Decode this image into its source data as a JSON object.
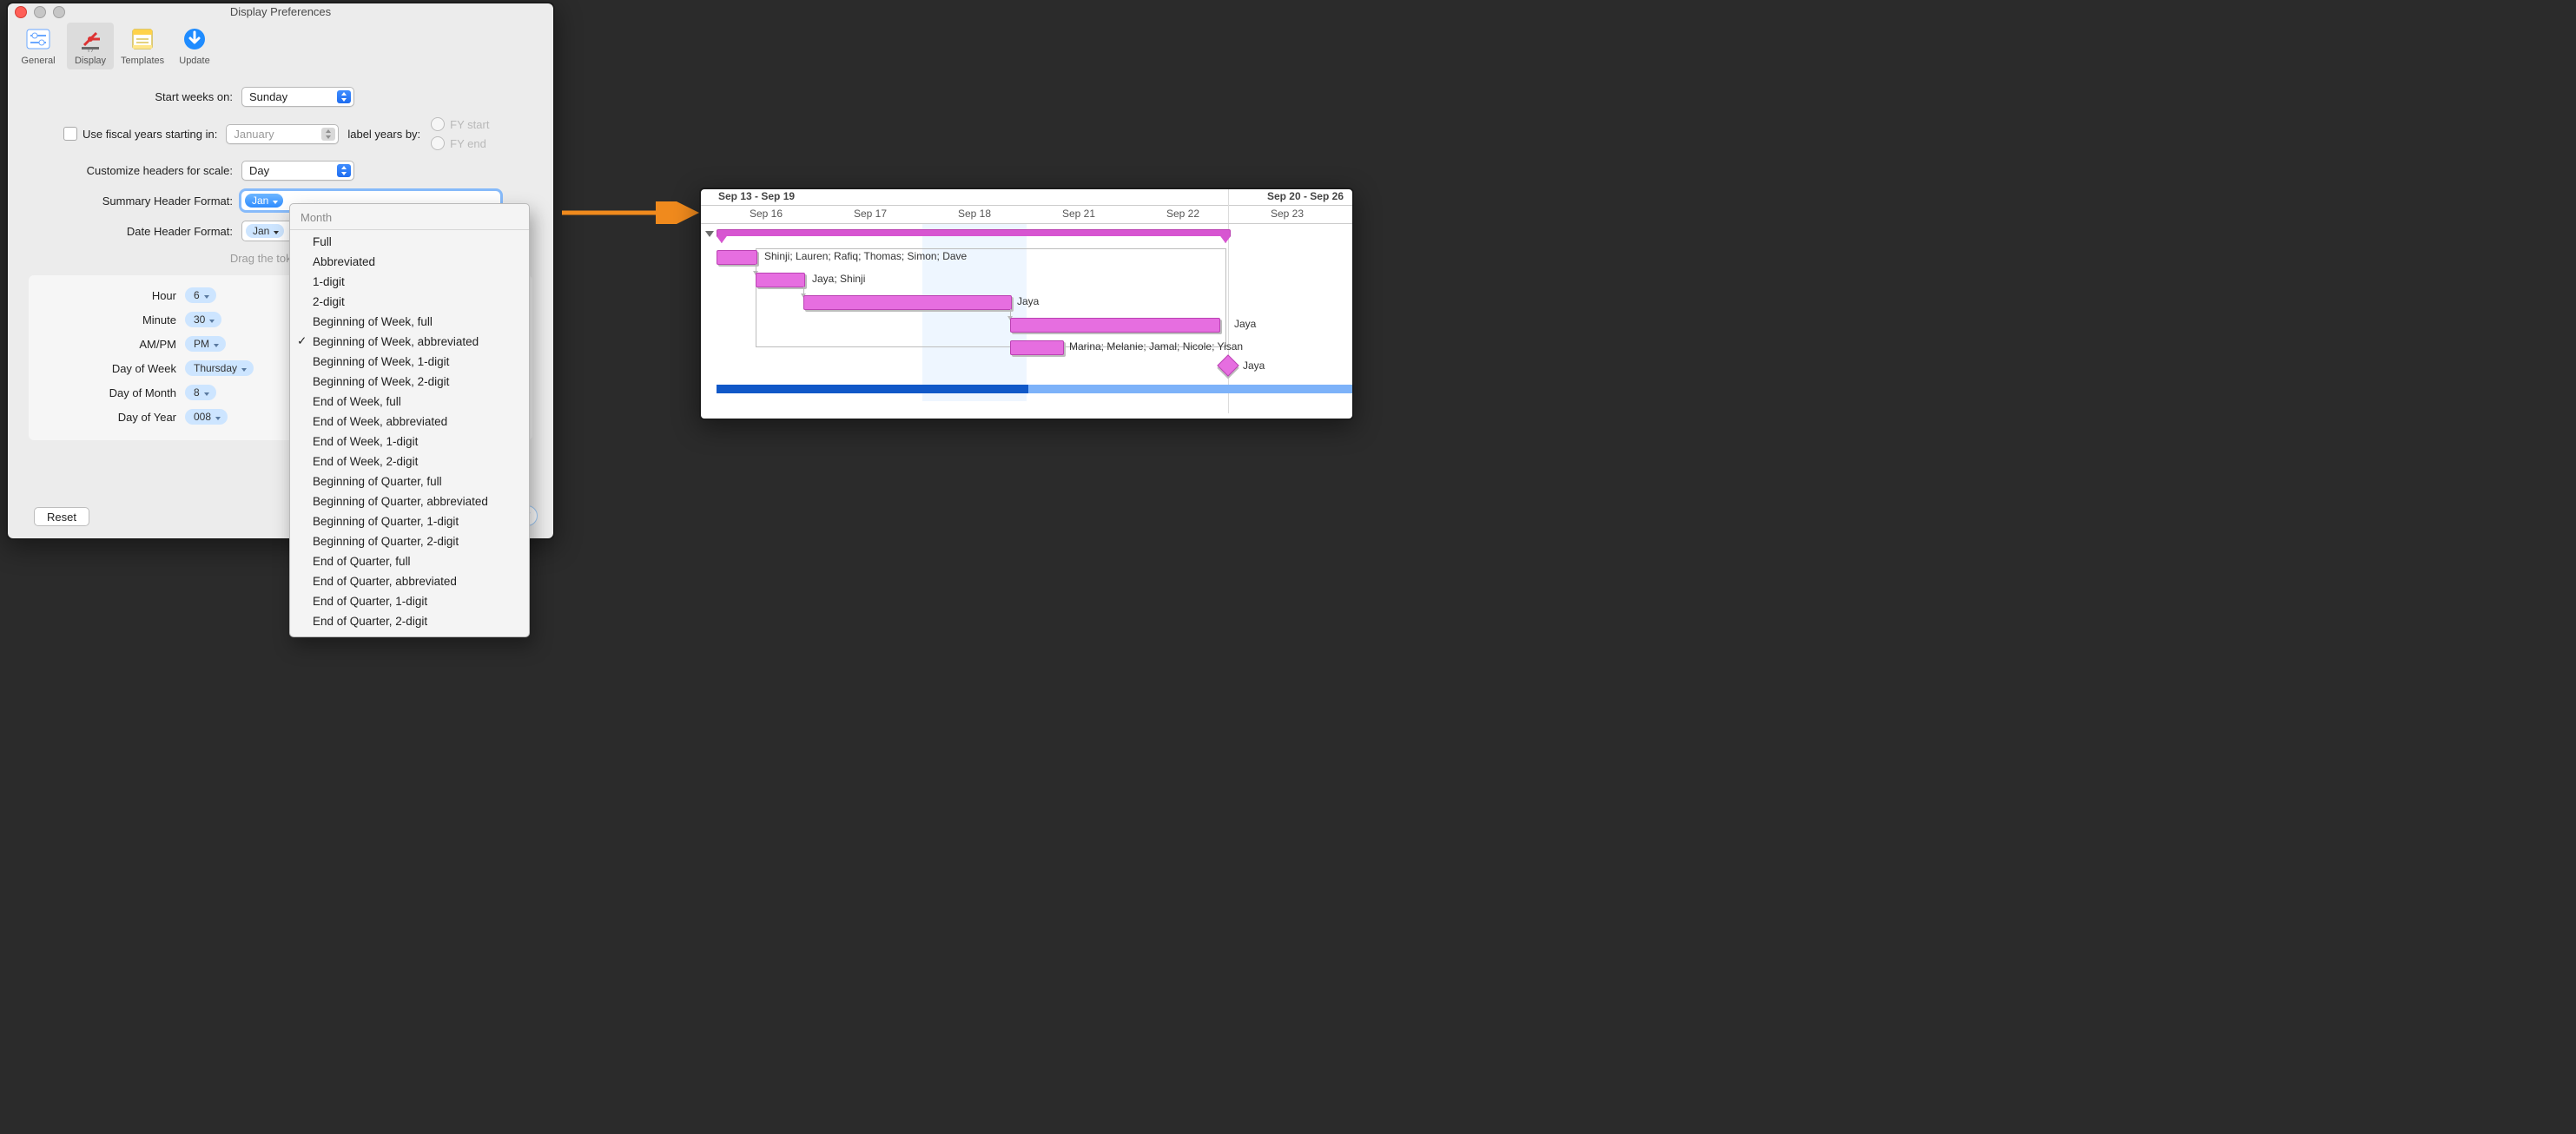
{
  "window": {
    "title": "Display Preferences",
    "tabs": [
      "General",
      "Display",
      "Templates",
      "Update"
    ],
    "selected_tab": "Display"
  },
  "form": {
    "start_weeks_label": "Start weeks on:",
    "start_weeks_value": "Sunday",
    "fiscal_check_label": "Use fiscal years starting in:",
    "fiscal_month": "January",
    "label_years_by": "label years by:",
    "fy_start": "FY start",
    "fy_end": "FY end",
    "customize_label": "Customize headers for scale:",
    "customize_value": "Day",
    "summary_label": "Summary Header Format:",
    "summary_token": "Jan",
    "date_label": "Date Header Format:",
    "date_token": "Jan",
    "hint": "Drag the tokens you"
  },
  "palette": {
    "hour": {
      "lbl": "Hour",
      "val": "6"
    },
    "minute": {
      "lbl": "Minute",
      "val": "30"
    },
    "ampm": {
      "lbl": "AM/PM",
      "val": "PM"
    },
    "dayofweek": {
      "lbl": "Day of Week",
      "val": "Thursday"
    },
    "dayofmonth": {
      "lbl": "Day of Month",
      "val": "8"
    },
    "dayofyear": {
      "lbl": "Day of Year",
      "val": "008"
    }
  },
  "buttons": {
    "reset": "Reset"
  },
  "dropdown": {
    "title": "Month",
    "items": [
      "Full",
      "Abbreviated",
      "1-digit",
      "2-digit",
      "Beginning of Week, full",
      "Beginning of Week, abbreviated",
      "Beginning of Week, 1-digit",
      "Beginning of Week, 2-digit",
      "End of Week, full",
      "End of Week, abbreviated",
      "End of Week, 1-digit",
      "End of Week, 2-digit",
      "Beginning of Quarter, full",
      "Beginning of Quarter, abbreviated",
      "Beginning of Quarter, 1-digit",
      "Beginning of Quarter, 2-digit",
      "End of Quarter, full",
      "End of Quarter, abbreviated",
      "End of Quarter, 1-digit",
      "End of Quarter, 2-digit"
    ],
    "selected_index": 5
  },
  "gantt": {
    "top_left": "Sep 13 - Sep 19",
    "top_right": "Sep 20 - Sep 26",
    "day_headers": [
      "Sep 16",
      "Sep 17",
      "Sep 18",
      "Sep 21",
      "Sep 22",
      "Sep 23"
    ],
    "tasks": {
      "t1": "Shinji; Lauren; Rafiq; Thomas; Simon; Dave",
      "t2": "Jaya; Shinji",
      "t3": "Jaya",
      "t4": "Jaya",
      "t5": "Marina; Melanie; Jamal; Nicole; Yisan",
      "t6": "Jaya"
    }
  }
}
